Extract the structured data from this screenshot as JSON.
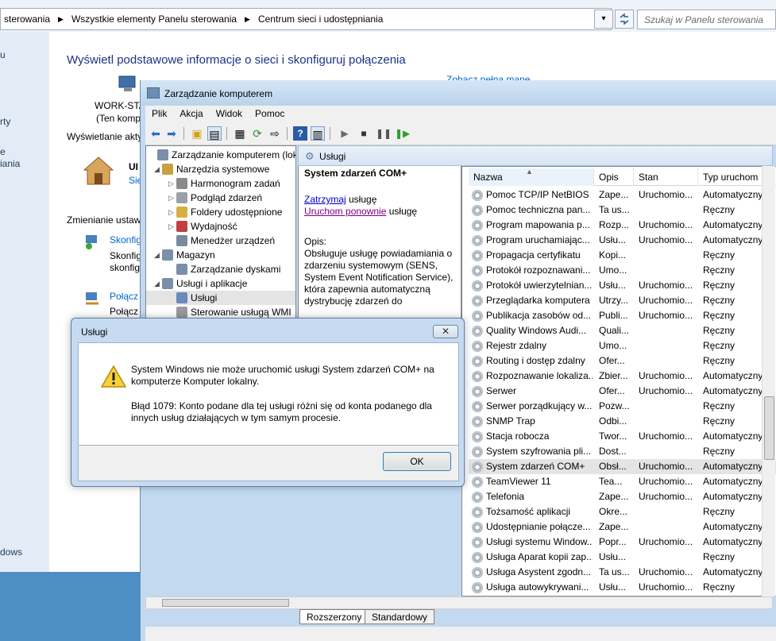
{
  "background_window": {
    "breadcrumb": [
      "sterowania",
      "Wszystkie elementy Panelu sterowania",
      "Centrum sieci i udostępniania"
    ],
    "search_placeholder": "Szukaj w Panelu sterowania",
    "left_fragments": [
      "u",
      "rty",
      "e",
      "iania",
      "dows"
    ],
    "heading": "Wyświetl podstawowe informacje o sieci i skonfiguruj połączenia",
    "see_map_link": "Zobacz pełną mapę",
    "computer_name": "WORK-STA",
    "computer_sub": "(Ten komp",
    "active_label": "Wyświetlanie akty",
    "network_name": "UI",
    "network_link": "Sie",
    "change_label": "Zmienianie ustaw",
    "configure_link": "Skonfig",
    "configure_desc1": "Skonfig",
    "configure_desc2": "skonfig",
    "connect_link": "Połącz",
    "connect_desc": "Połącz"
  },
  "mmc": {
    "title": "Zarządzanie komputerem",
    "menu": [
      "Plik",
      "Akcja",
      "Widok",
      "Pomoc"
    ],
    "tree": [
      {
        "label": "Zarządzanie komputerem (loka",
        "level": 0,
        "arrow": ""
      },
      {
        "label": "Narzędzia systemowe",
        "level": 1,
        "arrow": "◢"
      },
      {
        "label": "Harmonogram zadań",
        "level": 2,
        "arrow": "▷"
      },
      {
        "label": "Podgląd zdarzeń",
        "level": 2,
        "arrow": "▷"
      },
      {
        "label": "Foldery udostępnione",
        "level": 2,
        "arrow": "▷"
      },
      {
        "label": "Wydajność",
        "level": 2,
        "arrow": "▷"
      },
      {
        "label": "Menedżer urządzeń",
        "level": 2,
        "arrow": ""
      },
      {
        "label": "Magazyn",
        "level": 1,
        "arrow": "◢"
      },
      {
        "label": "Zarządzanie dyskami",
        "level": 2,
        "arrow": ""
      },
      {
        "label": "Usługi i aplikacje",
        "level": 1,
        "arrow": "◢"
      },
      {
        "label": "Usługi",
        "level": 2,
        "arrow": ""
      },
      {
        "label": "Sterowanie usługą WMI",
        "level": 2,
        "arrow": ""
      }
    ],
    "pane_title": "Usługi",
    "service_title": "System zdarzeń COM+",
    "stop_link": "Zatrzymaj",
    "stop_suffix": " usługę",
    "restart_link": "Uruchom ponownie",
    "restart_suffix": " usługę",
    "desc_label": "Opis:",
    "desc_text": "Obsługuje usługę powiadamiania o zdarzeniu systemowym (SENS, System Event Notification Service), która zapewnia automatyczną dystrybucję zdarzeń do",
    "columns": [
      "Nazwa",
      "Opis",
      "Stan",
      "Typ uruchom"
    ],
    "rows": [
      {
        "name": "Pomoc TCP/IP NetBIOS",
        "desc": "Zape...",
        "state": "Uruchomio...",
        "type": "Automatyczny"
      },
      {
        "name": "Pomoc techniczna pan...",
        "desc": "Ta us...",
        "state": "",
        "type": "Ręczny"
      },
      {
        "name": "Program mapowania p...",
        "desc": "Rozp...",
        "state": "Uruchomio...",
        "type": "Automatyczny"
      },
      {
        "name": "Program uruchamiając...",
        "desc": "Usłu...",
        "state": "Uruchomio...",
        "type": "Automatyczny"
      },
      {
        "name": "Propagacja certyfikatu",
        "desc": "Kopi...",
        "state": "",
        "type": "Ręczny"
      },
      {
        "name": "Protokół rozpoznawani...",
        "desc": "Umo...",
        "state": "",
        "type": "Ręczny"
      },
      {
        "name": "Protokół uwierzytelnian...",
        "desc": "Usłu...",
        "state": "Uruchomio...",
        "type": "Ręczny"
      },
      {
        "name": "Przeglądarka komputera",
        "desc": "Utrzy...",
        "state": "Uruchomio...",
        "type": "Ręczny"
      },
      {
        "name": "Publikacja zasobów od...",
        "desc": "Publi...",
        "state": "Uruchomio...",
        "type": "Ręczny"
      },
      {
        "name": "Quality Windows Audi...",
        "desc": "Quali...",
        "state": "",
        "type": "Ręczny"
      },
      {
        "name": "Rejestr zdalny",
        "desc": "Umo...",
        "state": "",
        "type": "Ręczny"
      },
      {
        "name": "Routing i dostęp zdalny",
        "desc": "Ofer...",
        "state": "",
        "type": "Ręczny"
      },
      {
        "name": "Rozpoznawanie lokaliza...",
        "desc": "Zbier...",
        "state": "Uruchomio...",
        "type": "Automatyczny"
      },
      {
        "name": "Serwer",
        "desc": "Ofer...",
        "state": "Uruchomio...",
        "type": "Automatyczny"
      },
      {
        "name": "Serwer porządkujący w...",
        "desc": "Pozw...",
        "state": "",
        "type": "Ręczny"
      },
      {
        "name": "SNMP Trap",
        "desc": "Odbi...",
        "state": "",
        "type": "Ręczny"
      },
      {
        "name": "Stacja robocza",
        "desc": "Twor...",
        "state": "Uruchomio...",
        "type": "Automatyczny"
      },
      {
        "name": "System szyfrowania pli...",
        "desc": "Dost...",
        "state": "",
        "type": "Ręczny"
      },
      {
        "name": "System zdarzeń COM+",
        "desc": "Obsł...",
        "state": "Uruchomio...",
        "type": "Automatyczny"
      },
      {
        "name": "TeamViewer 11",
        "desc": "Tea...",
        "state": "Uruchomio...",
        "type": "Automatyczny"
      },
      {
        "name": "Telefonia",
        "desc": "Zape...",
        "state": "Uruchomio...",
        "type": "Automatyczny"
      },
      {
        "name": "Tożsamość aplikacji",
        "desc": "Okre...",
        "state": "",
        "type": "Ręczny"
      },
      {
        "name": "Udostępnianie połącze...",
        "desc": "Zape...",
        "state": "",
        "type": "Automatyczny"
      },
      {
        "name": "Usługi systemu Window...",
        "desc": "Popr...",
        "state": "Uruchomio...",
        "type": "Automatyczny"
      },
      {
        "name": "Usługa Aparat kopii zap...",
        "desc": "Usłu...",
        "state": "",
        "type": "Ręczny"
      },
      {
        "name": "Usługa Asystent zgodn...",
        "desc": "Ta us...",
        "state": "Uruchomio...",
        "type": "Automatyczny"
      },
      {
        "name": "Usługa autowykrywani...",
        "desc": "Usłu...",
        "state": "Uruchomio...",
        "type": "Ręczny"
      }
    ],
    "selected_row": "System zdarzeń COM+",
    "tabs": [
      "Rozszerzony",
      "Standardowy"
    ]
  },
  "dialog": {
    "title": "Usługi",
    "message1": "System Windows nie może uruchomić usługi System zdarzeń COM+ na komputerze Komputer lokalny.",
    "message2": "Błąd 1079: Konto podane dla tej usługi różni się od konta podanego dla innych usług działających w tym samym procesie.",
    "ok_label": "OK",
    "close_glyph": "✕",
    "icon": "warning-icon"
  },
  "colors": {
    "accent_title": "#1e3287",
    "link": "#0000cc",
    "selection": "#e4e4e4"
  }
}
